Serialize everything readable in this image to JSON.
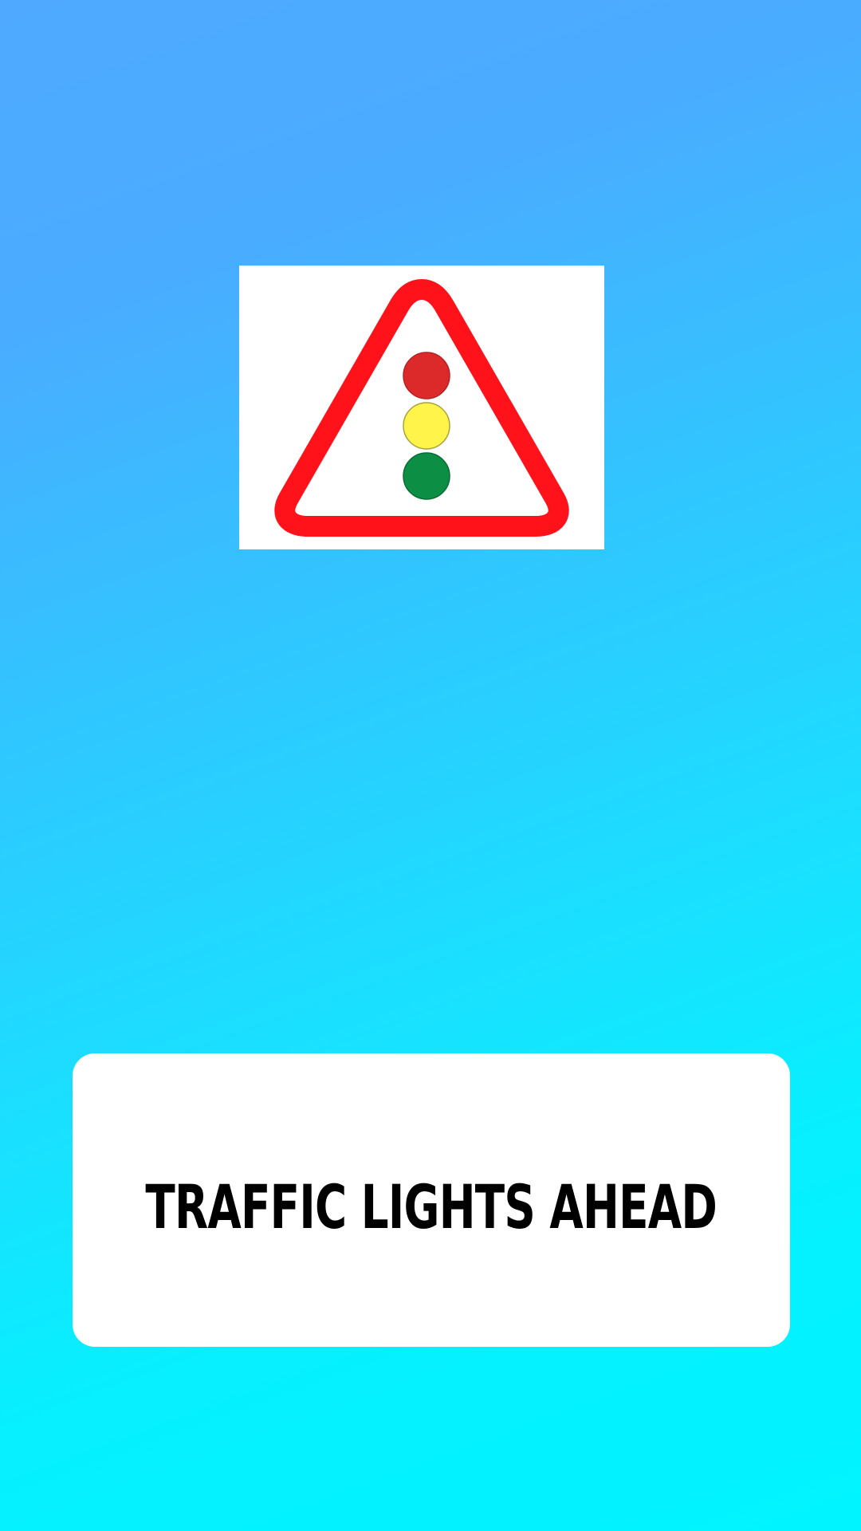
{
  "sign": {
    "icon": "traffic-lights-warning-sign-icon",
    "colors": {
      "border": "#ff121a",
      "red_light": "#dc2a2a",
      "yellow_light": "#fff44a",
      "green_light": "#0c8f44"
    }
  },
  "label": {
    "text": "TRAFFIC LIGHTS AHEAD"
  },
  "colors": {
    "background_top": "#4faaff",
    "background_bottom": "#00f4ff"
  }
}
